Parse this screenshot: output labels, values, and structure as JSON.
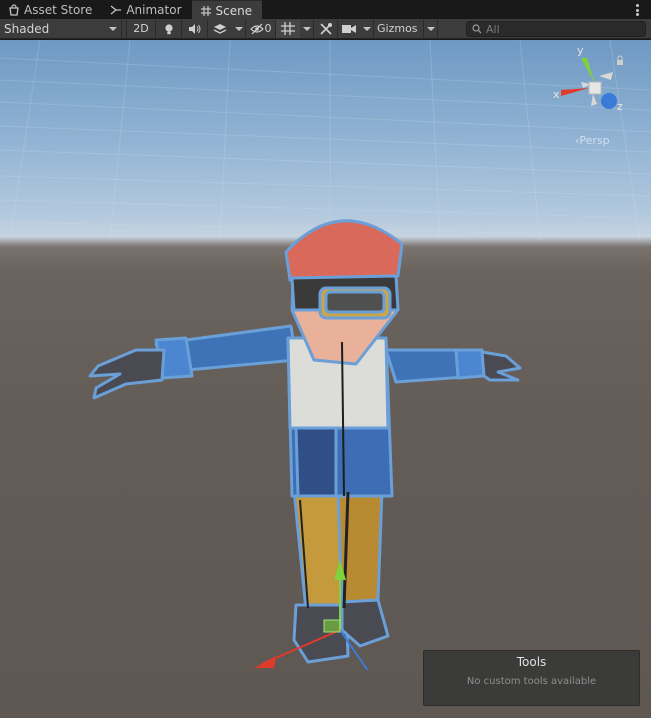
{
  "tabs": [
    {
      "label": "Asset Store",
      "icon": "store-icon",
      "active": false
    },
    {
      "label": "Animator",
      "icon": "animator-icon",
      "active": false
    },
    {
      "label": "Scene",
      "icon": "scene-grid-icon",
      "active": true
    }
  ],
  "toolbar": {
    "shading_mode": "Shaded",
    "two_d_label": "2D",
    "hidden_count": "0",
    "gizmos_label": "Gizmos",
    "search_placeholder": "All"
  },
  "scene": {
    "projection_label": "Persp",
    "axis_labels": {
      "x": "x",
      "y": "y",
      "z": "z"
    }
  },
  "tools_overlay": {
    "title": "Tools",
    "message": "No custom tools available"
  },
  "colors": {
    "x_axis": "#e03a2a",
    "y_axis": "#7ed23a",
    "z_axis": "#3a7bd8",
    "selection_outline": "#6a9fd8",
    "toolbar_bg": "#3c3c3c",
    "tab_bar_bg": "#191919"
  }
}
